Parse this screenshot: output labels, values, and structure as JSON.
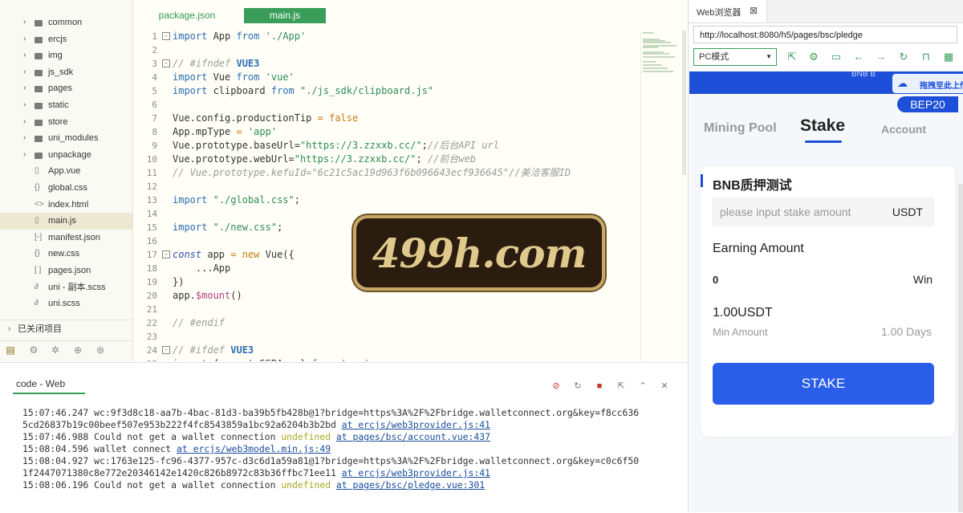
{
  "sidebar": {
    "items": [
      {
        "label": "common",
        "type": "folder"
      },
      {
        "label": "ercjs",
        "type": "folder"
      },
      {
        "label": "img",
        "type": "folder"
      },
      {
        "label": "js_sdk",
        "type": "folder"
      },
      {
        "label": "pages",
        "type": "folder"
      },
      {
        "label": "static",
        "type": "folder"
      },
      {
        "label": "store",
        "type": "folder"
      },
      {
        "label": "uni_modules",
        "type": "folder"
      },
      {
        "label": "unpackage",
        "type": "folder"
      },
      {
        "label": "App.vue",
        "type": "file",
        "icon": "▯"
      },
      {
        "label": "global.css",
        "type": "file",
        "icon": "{}"
      },
      {
        "label": "index.html",
        "type": "file",
        "icon": "<>"
      },
      {
        "label": "main.js",
        "type": "file",
        "icon": "▯",
        "selected": true
      },
      {
        "label": "manifest.json",
        "type": "file",
        "icon": "[◦]"
      },
      {
        "label": "new.css",
        "type": "file",
        "icon": "{}"
      },
      {
        "label": "pages.json",
        "type": "file",
        "icon": "[ ]"
      },
      {
        "label": "uni - 副本.scss",
        "type": "file",
        "icon": "∂"
      },
      {
        "label": "uni.scss",
        "type": "file",
        "icon": "∂"
      }
    ],
    "closed_projects": "已关闭项目"
  },
  "editor": {
    "tabs": [
      {
        "label": "package.json"
      },
      {
        "label": "main.js",
        "active": true
      }
    ],
    "lines": [
      {
        "n": "1",
        "fold": "-",
        "html": "<span class=\"k\">import</span> App <span class=\"k\">from</span> <span class=\"s\">'./App'</span>"
      },
      {
        "n": "2",
        "fold": "",
        "html": ""
      },
      {
        "n": "3",
        "fold": "-",
        "html": "<span class=\"c\">// #ifndef </span><span class=\"kb\">VUE3</span>"
      },
      {
        "n": "4",
        "fold": "",
        "html": "<span class=\"k\">import</span> Vue <span class=\"k\">from</span> <span class=\"s\">'vue'</span>"
      },
      {
        "n": "5",
        "fold": "",
        "html": "<span class=\"k\">import</span> clipboard <span class=\"k\">from</span> <span class=\"s\">\"./js_sdk/clipboard.js\"</span>"
      },
      {
        "n": "6",
        "fold": "",
        "html": ""
      },
      {
        "n": "7",
        "fold": "",
        "html": "Vue.config.productionTip <span class=\"b\">=</span> <span class=\"b\">false</span>"
      },
      {
        "n": "8",
        "fold": "",
        "html": "App.mpType <span class=\"b\">=</span> <span class=\"s\">'app'</span>"
      },
      {
        "n": "9",
        "fold": "",
        "html": "Vue.prototype.baseUrl=<span class=\"s\">\"https://3.zzxxb.cc/\"</span>;<span class=\"c\">//后台API url</span>"
      },
      {
        "n": "10",
        "fold": "",
        "html": "Vue.prototype.webUrl=<span class=\"s\">\"https://3.zzxxb.cc/\"</span>; <span class=\"c\">//前台web</span>"
      },
      {
        "n": "11",
        "fold": "",
        "html": "<span class=\"c\">// Vue.prototype.kefuId=\"6c21c5ac19d963f6b096643ecf936645\"//美洽客服ID</span>"
      },
      {
        "n": "12",
        "fold": "",
        "html": ""
      },
      {
        "n": "13",
        "fold": "",
        "html": "<span class=\"k\">import</span> <span class=\"s\">\"./global.css\"</span>;"
      },
      {
        "n": "14",
        "fold": "",
        "html": ""
      },
      {
        "n": "15",
        "fold": "",
        "html": "<span class=\"k\">import</span> <span class=\"s\">\"./new.css\"</span>;"
      },
      {
        "n": "16",
        "fold": "",
        "html": ""
      },
      {
        "n": "17",
        "fold": "-",
        "html": "<span class=\"i\">const</span> app <span class=\"b\">=</span> <span class=\"b\">new</span> Vue({"
      },
      {
        "n": "18",
        "fold": "",
        "html": "    ...App"
      },
      {
        "n": "19",
        "fold": "",
        "html": "})"
      },
      {
        "n": "20",
        "fold": "",
        "html": "app.<span class=\"p\">$mount</span>()"
      },
      {
        "n": "21",
        "fold": "",
        "html": ""
      },
      {
        "n": "22",
        "fold": "",
        "html": "<span class=\"c\">// #endif</span>"
      },
      {
        "n": "23",
        "fold": "",
        "html": ""
      },
      {
        "n": "24",
        "fold": "-",
        "html": "<span class=\"c\">// #ifdef </span><span class=\"kb\">VUE3</span>"
      },
      {
        "n": "25",
        "fold": "",
        "html": "<span class=\"k\">import</span> { createSSRApp } <span class=\"k\">from</span> <span class=\"s\">'vue'</span>"
      }
    ]
  },
  "watermark": "499h.com",
  "console": {
    "tab_label": "code - Web",
    "log": [
      {
        "html": "15:07:46.247 wc:9f3d8c18-aa7b-4bac-81d3-ba39b5fb428b@1?bridge=https%3A%2F%2Fbridge.walletconnect.org&key=f8cc636"
      },
      {
        "html": "5cd26837b19c00beef507e953b222f4fc8543859a1bc92a6204b3b2bd <span class=\"lnk\">at ercjs/web3provider.js:41</span>"
      },
      {
        "html": "15:07:46.988 Could not get a wallet connection <span class=\"undef\">undefined</span> <span class=\"lnk\">at pages/bsc/account.vue:437</span>"
      },
      {
        "html": "15:08:04.596 wallet connect <span class=\"lnk\">at ercjs/web3model.min.js:49</span>"
      },
      {
        "html": "15:08:04.927 wc:1763e125-fc96-4377-957c-d3c6d1a59a81@1?bridge=https%3A%2F%2Fbridge.walletconnect.org&key=c0c6f50"
      },
      {
        "html": "1f2447071380c8e772e20346142e1420c826b8972c83b36ffbc71ee11 <span class=\"lnk\">at ercjs/web3provider.js:41</span>"
      },
      {
        "html": "15:08:06.196 Could not get a wallet connection <span class=\"undef\">undefined</span> <span class=\"lnk\">at pages/bsc/pledge.vue:301</span>"
      }
    ]
  },
  "browser": {
    "tab_label": "Web浏览器",
    "url": "http://localhost:8080/h5/pages/bsc/pledge",
    "mode": "PC模式"
  },
  "app": {
    "header_text": "BNB B",
    "drag_hint": "拖拽至此上传",
    "badge": "BEP20",
    "nav": {
      "mining": "Mining Pool",
      "stake": "Stake",
      "account": "Account"
    },
    "card": {
      "title": "BNB质押测试",
      "input_placeholder": "please input stake amount",
      "input_unit": "USDT",
      "earning_label": "Earning Amount",
      "earning_value": "0",
      "earning_unit": "Win",
      "min_value": "1.00USDT",
      "min_label": "Min Amount",
      "days": "1.00 Days",
      "button": "STAKE"
    }
  },
  "colors": {
    "accent_green": "#3a9e5a",
    "app_blue": "#1d4fd8"
  }
}
